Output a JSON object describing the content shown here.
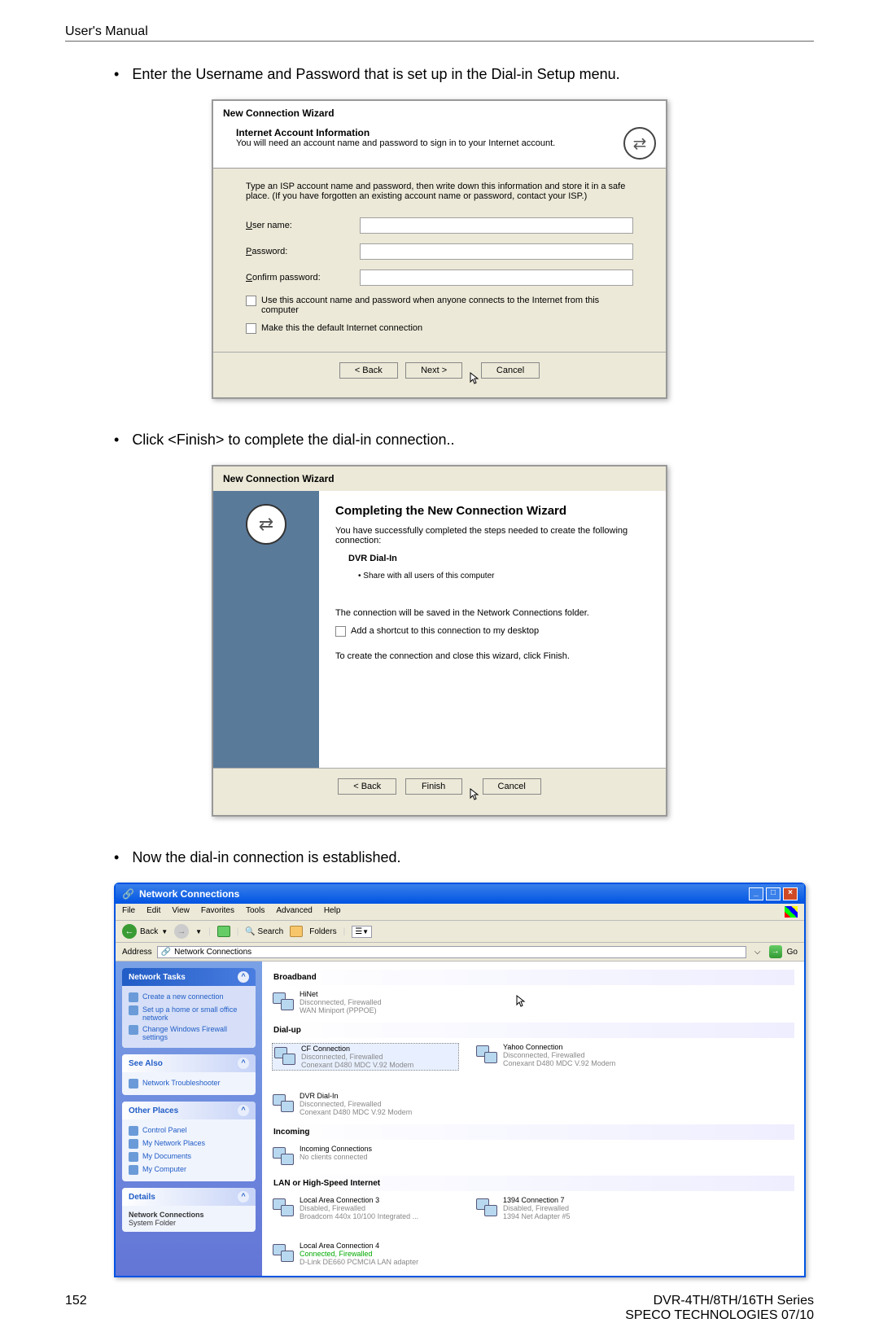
{
  "page": {
    "header": "User's Manual",
    "page_number": "152",
    "footer_line1": "DVR-4TH/8TH/16TH Series",
    "footer_line2": "SPECO TECHNOLOGIES 07/10"
  },
  "bullets": {
    "b1": "Enter the Username and Password that is set up in the Dial-in Setup menu.",
    "b2": "Click <Finish> to complete the dial-in connection..",
    "b3": "Now the dial-in connection is established."
  },
  "wizard1": {
    "title": "New Connection Wizard",
    "heading": "Internet Account Information",
    "subheading": "You will need an account name and password to sign in to your Internet account.",
    "desc": "Type an ISP account name and password, then write down this information and store it in a safe place. (If you have forgotten an existing account name or password, contact your ISP.)",
    "username_label": "User name:",
    "password_label": "Password:",
    "confirm_label": "Confirm password:",
    "check1": "Use this account name and password when anyone connects to the Internet from this computer",
    "check2": "Make this the default Internet connection",
    "back": "< Back",
    "next": "Next >",
    "cancel": "Cancel"
  },
  "wizard2": {
    "title": "New Connection Wizard",
    "heading": "Completing the New Connection Wizard",
    "line1": "You have successfully completed the steps needed to create the following connection:",
    "conn_name": "DVR Dial-In",
    "share": "Share with all users of this computer",
    "line2": "The connection will be saved in the Network Connections folder.",
    "shortcut": "Add a shortcut to this connection to my desktop",
    "line3": "To create the connection and close this wizard, click Finish.",
    "back": "< Back",
    "finish": "Finish",
    "cancel": "Cancel"
  },
  "nc": {
    "title": "Network Connections",
    "menu": {
      "file": "File",
      "edit": "Edit",
      "view": "View",
      "favorites": "Favorites",
      "tools": "Tools",
      "advanced": "Advanced",
      "help": "Help"
    },
    "toolbar": {
      "back": "Back",
      "search": "Search",
      "folders": "Folders"
    },
    "address_label": "Address",
    "address_value": "Network Connections",
    "go": "Go",
    "panels": {
      "tasks_title": "Network Tasks",
      "task1": "Create a new connection",
      "task2": "Set up a home or small office network",
      "task3": "Change Windows Firewall settings",
      "seealso_title": "See Also",
      "seealso1": "Network Troubleshooter",
      "other_title": "Other Places",
      "other1": "Control Panel",
      "other2": "My Network Places",
      "other3": "My Documents",
      "other4": "My Computer",
      "details_title": "Details",
      "details1": "Network Connections",
      "details2": "System Folder"
    },
    "sections": {
      "broadband": "Broadband",
      "dialup": "Dial-up",
      "incoming": "Incoming",
      "lan": "LAN or High-Speed Internet"
    },
    "conns": {
      "hinet_name": "HiNet",
      "hinet_status": "Disconnected, Firewalled",
      "hinet_dev": "WAN Miniport (PPPOE)",
      "cf_name": "CF Connection",
      "cf_status": "Disconnected, Firewalled",
      "cf_dev": "Conexant D480 MDC V.92 Modem",
      "yahoo_name": "Yahoo Connection",
      "yahoo_status": "Disconnected, Firewalled",
      "yahoo_dev": "Conexant D480 MDC V.92 Modem",
      "dvr_name": "DVR Dial-In",
      "dvr_status": "Disconnected, Firewalled",
      "dvr_dev": "Conexant D480 MDC V.92 Modem",
      "inc_name": "Incoming Connections",
      "inc_status": "No clients connected",
      "lan3_name": "Local Area Connection 3",
      "lan3_status": "Disabled, Firewalled",
      "lan3_dev": "Broadcom 440x 10/100 Integrated ...",
      "c1394_name": "1394 Connection 7",
      "c1394_status": "Disabled, Firewalled",
      "c1394_dev": "1394 Net Adapter #5",
      "lan4_name": "Local Area Connection 4",
      "lan4_status": "Connected, Firewalled",
      "lan4_dev": "D-Link DE660 PCMCIA LAN adapter"
    }
  }
}
